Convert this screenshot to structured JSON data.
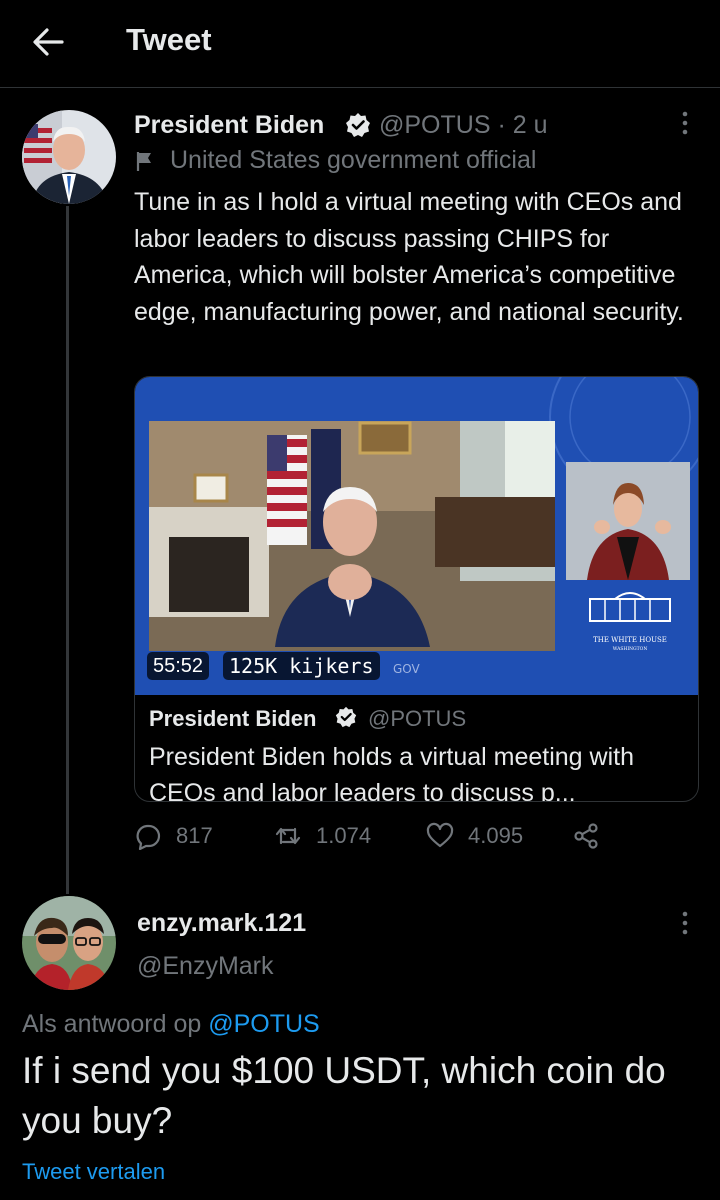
{
  "header": {
    "title": "Tweet",
    "back_icon": "arrow-left-icon"
  },
  "tweet": {
    "author_name": "President Biden",
    "handle": "@POTUS",
    "separator": "·",
    "time": "2 u",
    "label": "United States government official",
    "text": "Tune in as I hold a virtual meeting with CEOs and labor leaders to discuss passing CHIPS for America, which will bolster America’s competitive edge, manufacturing power, and national security.",
    "video": {
      "duration": "55:52",
      "views": "125K kijkers",
      "watermark_tail": "GOV",
      "seal_title": "THE WHITE HOUSE",
      "seal_sub": "WASHINGTON"
    },
    "card": {
      "author_name": "President Biden",
      "handle": "@POTUS",
      "text": "President Biden holds a virtual meeting with CEOs and labor leaders to discuss p..."
    },
    "actions": {
      "replies": "817",
      "retweets": "1.074",
      "likes": "4.095"
    }
  },
  "reply": {
    "author_name": "enzy.mark.121",
    "handle": "@EnzyMark",
    "reply_prefix": "Als antwoord op",
    "reply_mention": "@POTUS",
    "text": "If i send you $100 USDT, which coin do you buy?",
    "translate": "Tweet vertalen"
  },
  "colors": {
    "background": "#000000",
    "text": "#e7e9ea",
    "secondary": "#71767b",
    "accent": "#1d9bf0",
    "verified": "#e7e9ea"
  }
}
